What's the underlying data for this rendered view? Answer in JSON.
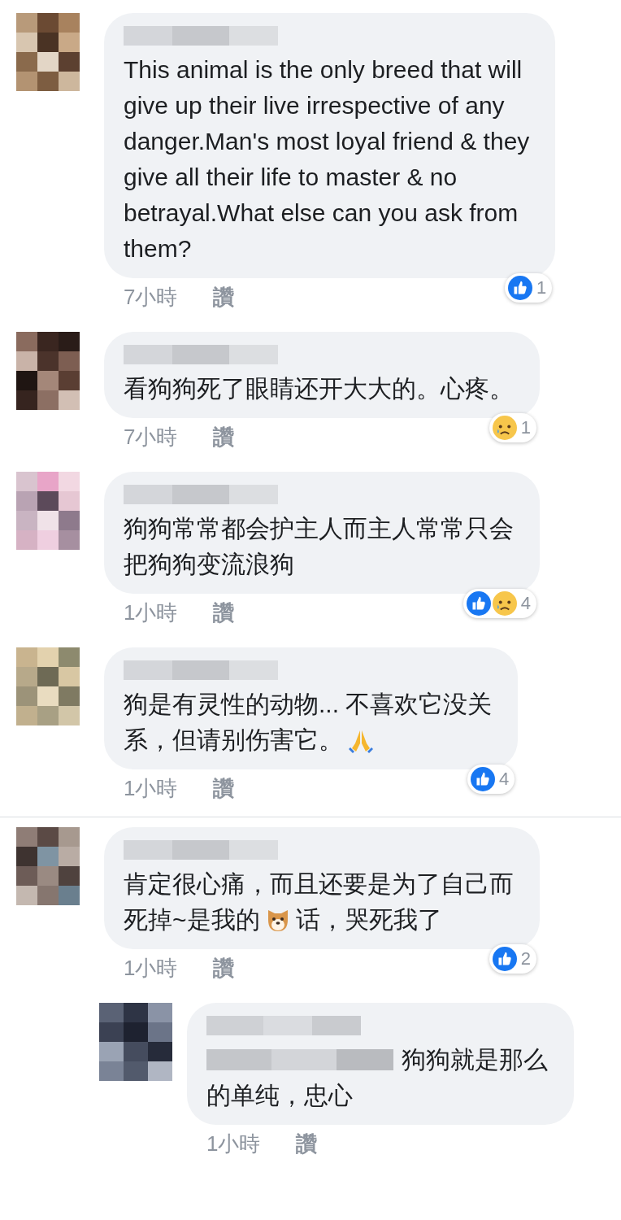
{
  "comments": [
    {
      "divider_above": false,
      "lines": [
        [
          {
            "kind": "text",
            "text": "This animal is the only breed that will\ngive up their live irrespective of any\ndanger.Man's most loyal friend & they\ngive all their life to master & no\nbetrayal.What else can you ask from\nthem?"
          }
        ]
      ],
      "time": "7小時",
      "like_label": "讚",
      "reactions": [
        {
          "kind": "like"
        }
      ],
      "reaction_count": "1"
    },
    {
      "divider_above": false,
      "lines": [
        [
          {
            "kind": "text",
            "text": "看狗狗死了眼睛还开大大的。心疼。"
          }
        ]
      ],
      "time": "7小時",
      "like_label": "讚",
      "reactions": [
        {
          "kind": "sad"
        }
      ],
      "reaction_count": "1"
    },
    {
      "divider_above": false,
      "lines": [
        [
          {
            "kind": "text",
            "text": "狗狗常常都会护主人而主人常常只会"
          }
        ],
        [
          {
            "kind": "text",
            "text": "把狗狗变流浪狗"
          }
        ]
      ],
      "time": "1小時",
      "like_label": "讚",
      "reactions": [
        {
          "kind": "like"
        },
        {
          "kind": "sad"
        }
      ],
      "reaction_count": "4"
    },
    {
      "divider_above": false,
      "lines": [
        [
          {
            "kind": "text",
            "text": "狗是有灵性的动物... 不喜欢它没关"
          }
        ],
        [
          {
            "kind": "text",
            "text": "系，但请别伤害它。"
          },
          {
            "kind": "pray"
          }
        ]
      ],
      "time": "1小時",
      "like_label": "讚",
      "reactions": [
        {
          "kind": "like"
        }
      ],
      "reaction_count": "4"
    },
    {
      "divider_above": true,
      "lines": [
        [
          {
            "kind": "text",
            "text": "肯定很心痛，而且还要是为了自己而"
          }
        ],
        [
          {
            "kind": "text",
            "text": "死掉~是我的"
          },
          {
            "kind": "dog"
          },
          {
            "kind": "text",
            "text": "话，哭死我了"
          }
        ]
      ],
      "time": "1小時",
      "like_label": "讚",
      "reactions": [
        {
          "kind": "like"
        }
      ],
      "reaction_count": "2",
      "replies": [
        {
          "lines": [
            [
              {
                "kind": "redacted"
              },
              {
                "kind": "text",
                "text": "狗狗就是那么"
              }
            ],
            [
              {
                "kind": "text",
                "text": "的单纯，忠心"
              }
            ]
          ],
          "time": "1小時",
          "like_label": "讚"
        }
      ]
    }
  ]
}
